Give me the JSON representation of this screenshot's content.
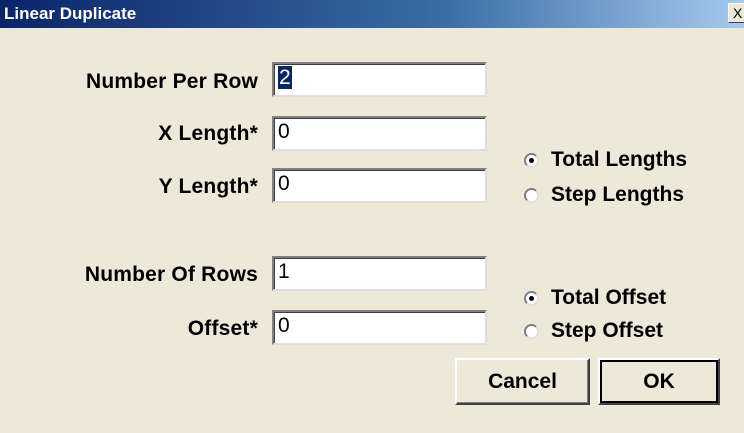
{
  "window": {
    "title": "Linear Duplicate",
    "close_label": "X"
  },
  "form": {
    "number_per_row": {
      "label": "Number Per Row",
      "value": "2"
    },
    "x_length": {
      "label": "X Length*",
      "value": "0"
    },
    "y_length": {
      "label": "Y Length*",
      "value": "0"
    },
    "number_of_rows": {
      "label": "Number Of Rows",
      "value": "1"
    },
    "offset": {
      "label": "Offset*",
      "value": "0"
    }
  },
  "length_mode": {
    "options": [
      {
        "label": "Total Lengths",
        "selected": true
      },
      {
        "label": "Step Lengths",
        "selected": false
      }
    ]
  },
  "offset_mode": {
    "options": [
      {
        "label": "Total Offset",
        "selected": true
      },
      {
        "label": "Step Offset",
        "selected": false
      }
    ]
  },
  "buttons": {
    "cancel": "Cancel",
    "ok": "OK"
  }
}
